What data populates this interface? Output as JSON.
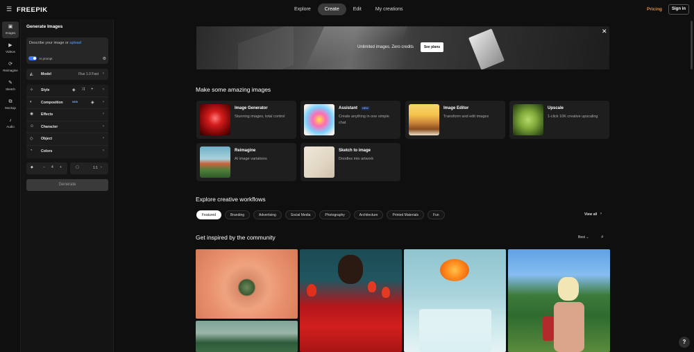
{
  "header": {
    "logo": "FREEPIK",
    "nav": [
      "Explore",
      "Create",
      "Edit",
      "My creations"
    ],
    "active_nav": "Create",
    "pricing": "Pricing",
    "signin": "Sign in"
  },
  "rail": {
    "items": [
      {
        "label": "Images",
        "icon": "image-icon"
      },
      {
        "label": "Videos",
        "icon": "video-icon"
      },
      {
        "label": "Reimagine",
        "icon": "reimagine-icon"
      },
      {
        "label": "Sketch",
        "icon": "pencil-icon"
      },
      {
        "label": "Mockup",
        "icon": "mockup-icon"
      },
      {
        "label": "Audio",
        "icon": "audio-icon"
      }
    ]
  },
  "panel": {
    "title": "Generate Images",
    "prompt_placeholder": "Describe your image or ",
    "prompt_upload": "upload",
    "ai_prompt": "AI prompt",
    "model_label": "Model",
    "model_value": "Flux 1.0 Fast",
    "options": [
      {
        "label": "Style",
        "icon": "style-icon"
      },
      {
        "label": "Composition",
        "icon": "composition-icon",
        "badge": "NEW"
      },
      {
        "label": "Effects",
        "icon": "effects-icon"
      },
      {
        "label": "Character",
        "icon": "character-icon"
      },
      {
        "label": "Object",
        "icon": "object-icon"
      },
      {
        "label": "Colors",
        "icon": "colors-icon"
      }
    ],
    "count_value": "4",
    "ratio_value": "1:1",
    "generate": "Generate"
  },
  "banner": {
    "text": "Unlimited images. Zero credits",
    "button": "See plans"
  },
  "sections": {
    "make": "Make some amazing images",
    "workflows": "Explore creative workflows",
    "community": "Get inspired by the community"
  },
  "tools": [
    {
      "title": "Image Generator",
      "desc": "Stunning images, total control"
    },
    {
      "title": "Assistant",
      "desc": "Create anything in one simple chat",
      "badge": "NEW"
    },
    {
      "title": "Image Editor",
      "desc": "Transform and edit images"
    },
    {
      "title": "Upscale",
      "desc": "1-click 10K creative upscaling"
    },
    {
      "title": "Reimagine",
      "desc": "AI image variations"
    },
    {
      "title": "Sketch to image",
      "desc": "Doodles into artwork"
    }
  ],
  "chips": [
    "Featured",
    "Branding",
    "Advertising",
    "Social Media",
    "Photography",
    "Architecture",
    "Printed Materials",
    "Fun"
  ],
  "view_all": "View all",
  "sort": "Best",
  "help": "?"
}
